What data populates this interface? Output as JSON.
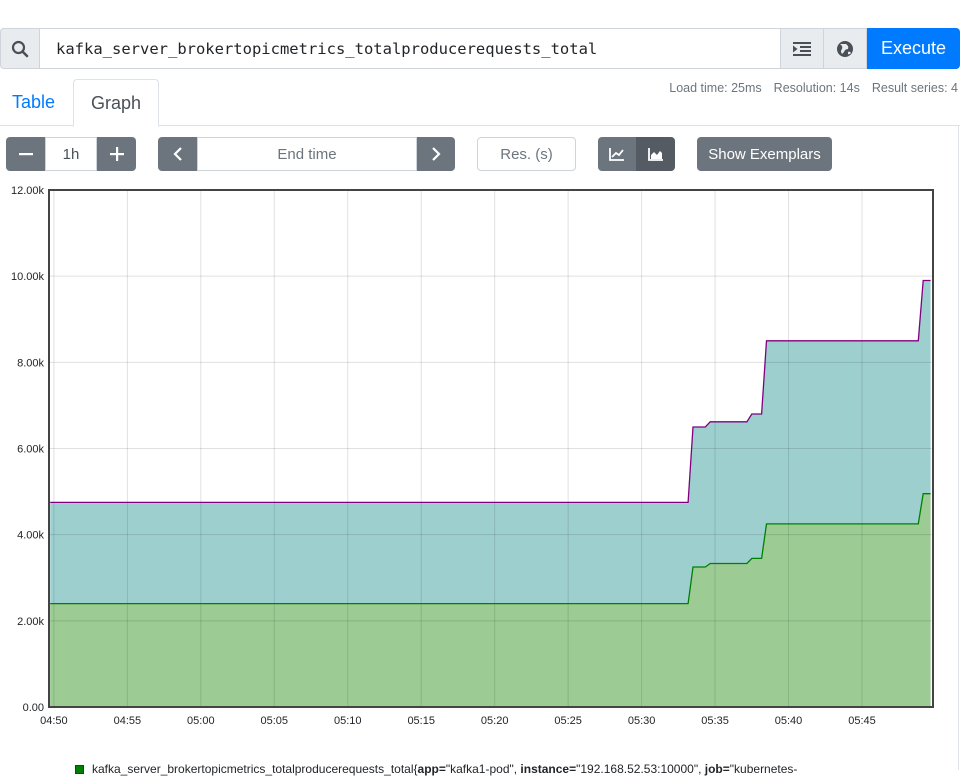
{
  "query": {
    "expression": "kafka_server_brokertopicmetrics_totalproducerequests_total",
    "execute_label": "Execute",
    "icons": [
      "search-icon",
      "format-indent-icon",
      "globe-icon"
    ]
  },
  "tabs": [
    {
      "label": "Table",
      "active": false
    },
    {
      "label": "Graph",
      "active": true
    }
  ],
  "stats": {
    "load_time": "Load time: 25ms",
    "resolution": "Resolution: 14s",
    "result_series": "Result series: 4"
  },
  "controls": {
    "range": "1h",
    "end_time_placeholder": "End time",
    "resolution_placeholder": "Res. (s)",
    "exemplars_label": "Show Exemplars",
    "stacked": true
  },
  "chart_data": {
    "type": "area",
    "stacked": true,
    "grid": true,
    "x_tick_labels": [
      "04:50",
      "04:55",
      "05:00",
      "05:05",
      "05:10",
      "05:15",
      "05:20",
      "05:25",
      "05:30",
      "05:35",
      "05:40",
      "05:45"
    ],
    "y_tick_labels": [
      "0.00",
      "2.00k",
      "4.00k",
      "6.00k",
      "8.00k",
      "10.00k",
      "12.00k"
    ],
    "xlim": [
      "04:49:40",
      "04:49:40"
    ],
    "ylim": [
      0,
      12000
    ],
    "series": [
      {
        "color": "#008000",
        "fill": "#9ccc93",
        "points": [
          [
            "04:49:45",
            2400
          ],
          [
            "05:33:10",
            2400
          ],
          [
            "05:33:30",
            3250
          ],
          [
            "05:34:20",
            3250
          ],
          [
            "05:34:40",
            3330
          ],
          [
            "05:37:10",
            3330
          ],
          [
            "05:37:30",
            3450
          ],
          [
            "05:38:10",
            3450
          ],
          [
            "05:38:30",
            4250
          ],
          [
            "05:48:50",
            4250
          ],
          [
            "05:49:10",
            4950
          ],
          [
            "05:49:40",
            4950
          ]
        ]
      },
      {
        "color": "#800080",
        "fill": "#9ecfcf",
        "points": [
          [
            "04:49:45",
            4750
          ],
          [
            "05:33:10",
            4750
          ],
          [
            "05:33:30",
            6500
          ],
          [
            "05:34:20",
            6500
          ],
          [
            "05:34:40",
            6620
          ],
          [
            "05:37:10",
            6620
          ],
          [
            "05:37:30",
            6800
          ],
          [
            "05:38:10",
            6800
          ],
          [
            "05:38:30",
            8500
          ],
          [
            "05:48:50",
            8500
          ],
          [
            "05:49:10",
            9900
          ],
          [
            "05:49:40",
            9900
          ]
        ]
      }
    ]
  },
  "legend": {
    "metric": "kafka_server_brokertopicmetrics_totalproducerequests_total{",
    "app_key": "app=",
    "app_val": "\"kafka1-pod\", ",
    "instance_key": "instance=",
    "instance_val": "\"192.168.52.53:10000\", ",
    "job_key": "job=",
    "job_val": "\"kubernetes-"
  }
}
